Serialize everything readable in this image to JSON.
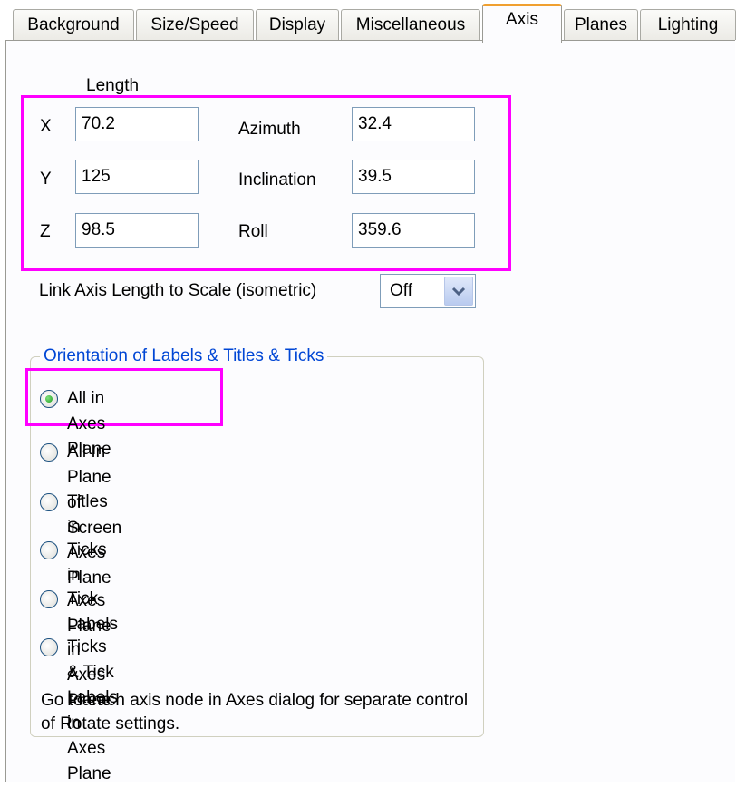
{
  "tabs": [
    {
      "label": "Background",
      "active": false
    },
    {
      "label": "Size/Speed",
      "active": false
    },
    {
      "label": "Display",
      "active": false
    },
    {
      "label": "Miscellaneous",
      "active": false
    },
    {
      "label": "Axis",
      "active": true
    },
    {
      "label": "Planes",
      "active": false
    },
    {
      "label": "Lighting",
      "active": false
    }
  ],
  "length_header": "Length",
  "axes": [
    {
      "axis": "X",
      "length": "70.2",
      "angle_label": "Azimuth",
      "angle_value": "32.4"
    },
    {
      "axis": "Y",
      "length": "125",
      "angle_label": "Inclination",
      "angle_value": "39.5"
    },
    {
      "axis": "Z",
      "length": "98.5",
      "angle_label": "Roll",
      "angle_value": "359.6"
    }
  ],
  "link_axis": {
    "label": "Link Axis Length to Scale (isometric)",
    "value": "Off"
  },
  "orientation": {
    "title": "Orientation of Labels & Titles & Ticks",
    "options": [
      {
        "label": "All in Axes Plane",
        "selected": true
      },
      {
        "label": "All In Plane of Screen",
        "selected": false
      },
      {
        "label": "Titles in Axes Plane",
        "selected": false
      },
      {
        "label": "Ticks in Axes Plane",
        "selected": false
      },
      {
        "label": "Tick Labels in Axes Plane",
        "selected": false
      },
      {
        "label": "Ticks & Tick Labels in Axes Plane",
        "selected": false
      }
    ],
    "note": "Go to each axis node in Axes dialog for separate control of Rotate settings."
  },
  "colors": {
    "highlight": "#ff00ff",
    "group_title": "#0046d5",
    "active_tab_accent": "#f0a030"
  },
  "icons": {
    "combo_arrow": "chevron-down-icon",
    "radio_on": "radio-checked-icon",
    "radio_off": "radio-unchecked-icon"
  }
}
